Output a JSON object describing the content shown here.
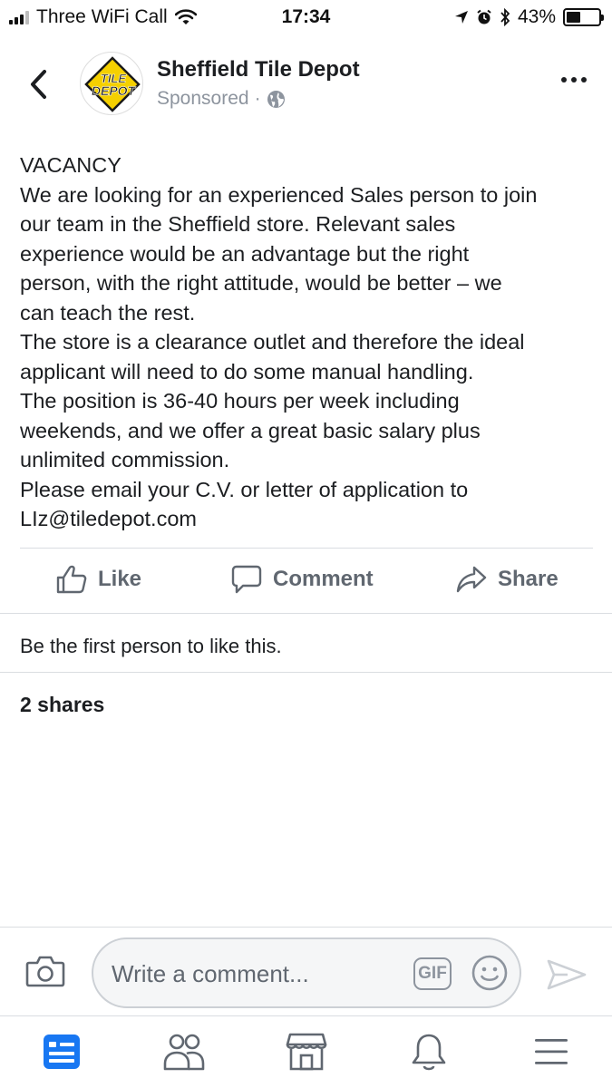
{
  "status_bar": {
    "carrier": "Three WiFi Call",
    "time": "17:34",
    "battery_percent": "43%",
    "battery_level": 0.43
  },
  "post": {
    "page_name": "Sheffield Tile Depot",
    "sponsored_label": "Sponsored",
    "separator": "·",
    "logo_text": [
      "TILE",
      "DEPOT"
    ],
    "body_lines": [
      "VACANCY",
      "We are looking for an experienced Sales person to join",
      "our team in the Sheffield store. Relevant sales",
      "experience would be an advantage but the right",
      "person, with the right attitude, would be better – we",
      "can teach the rest.",
      "The store is a clearance outlet and therefore the ideal",
      "applicant will need to do some manual handling.",
      "The position is 36-40 hours per week including",
      "weekends, and we offer a great basic salary plus",
      "unlimited commission.",
      "Please email your C.V. or letter of application to",
      "LIz@tiledepot.com"
    ]
  },
  "actions": {
    "like": "Like",
    "comment": "Comment",
    "share": "Share"
  },
  "engagement": {
    "likes_text": "Be the first person to like this.",
    "shares_text": "2 shares"
  },
  "composer": {
    "placeholder": "Write a comment...",
    "gif_label": "GIF"
  },
  "icons": {
    "header": [
      "back-chevron-icon",
      "globe-icon",
      "more-dots-icon"
    ],
    "actions": [
      "thumbs-up-icon",
      "speech-bubble-icon",
      "share-arrow-icon"
    ],
    "composer": [
      "camera-icon",
      "gif-icon",
      "emoji-icon",
      "send-icon"
    ],
    "tabs": [
      "news-feed-icon",
      "friends-icon",
      "marketplace-icon",
      "notifications-bell-icon",
      "menu-icon"
    ]
  },
  "colors": {
    "brand_blue": "#1877f2",
    "logo_yellow": "#f5d000",
    "muted_gray": "#606770",
    "divider": "#dadde1"
  }
}
